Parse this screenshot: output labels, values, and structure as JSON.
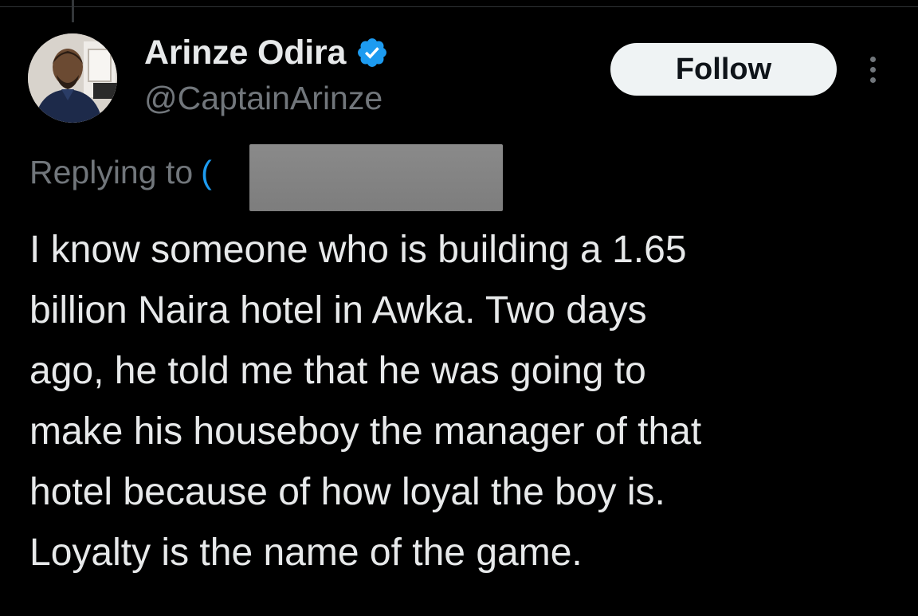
{
  "tweet": {
    "author": {
      "name": "Arinze Odira",
      "handle": "@CaptainArinze",
      "verified": true,
      "avatar": "profile-photo"
    },
    "follow_label": "Follow",
    "more_icon": "more-options-icon",
    "replying_to_label": "Replying to",
    "replying_to_mention": "(",
    "text_lines": [
      "I know someone who is building a 1.65",
      "billion Naira hotel in Awka. Two days",
      "ago, he told me that he was going to",
      "make his houseboy the manager of that",
      "hotel because of how loyal the boy is.",
      "Loyalty is the name of the game."
    ]
  },
  "colors": {
    "background": "#000000",
    "text_primary": "#e7e9ea",
    "text_secondary": "#71767b",
    "verified_badge": "#1d9bf0",
    "follow_button_bg": "#eff3f4",
    "follow_button_text": "#0f1419",
    "redaction": "#808080"
  }
}
